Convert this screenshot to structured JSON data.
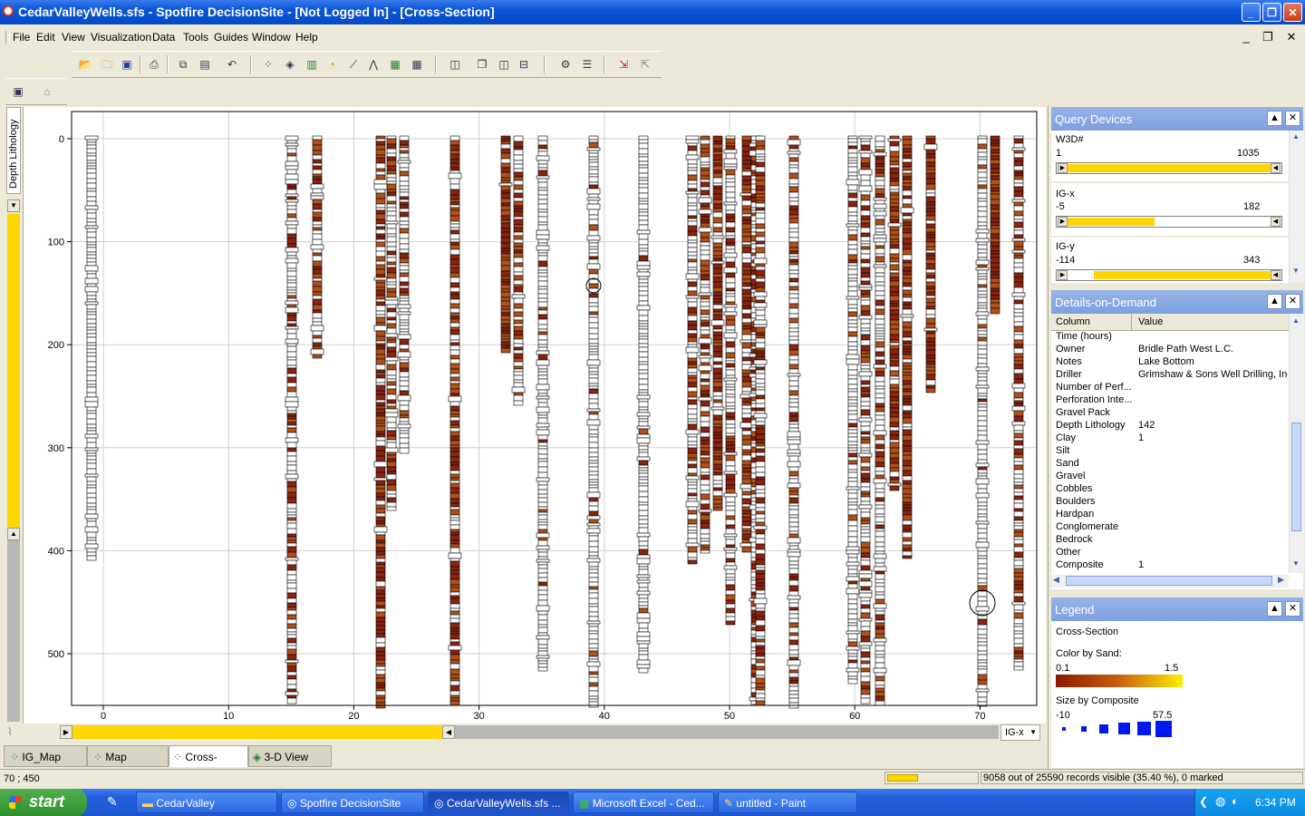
{
  "window": {
    "title": "CedarValleyWells.sfs - Spotfire DecisionSite - [Not Logged In] - [Cross-Section]"
  },
  "menu": [
    "File",
    "Edit",
    "View",
    "Visualization",
    "Data",
    "Tools",
    "Guides",
    "Window",
    "Help"
  ],
  "side_tab": {
    "label": "Depth Lithology"
  },
  "plot": {
    "x_ticks": [
      "0",
      "10",
      "20",
      "30",
      "40",
      "50",
      "60",
      "70"
    ],
    "y_ticks": [
      "0",
      "100",
      "200",
      "300",
      "400",
      "500"
    ],
    "x_axis_selector": "IG-x"
  },
  "query_devices": {
    "title": "Query Devices",
    "items": [
      {
        "label": "W3D#",
        "min": "1",
        "max": "1035",
        "range_lo": 0.0,
        "range_hi": 0.98
      },
      {
        "label": "IG-x",
        "min": "-5",
        "max": "182",
        "range_lo": 0.0,
        "range_hi": 0.43
      },
      {
        "label": "IG-y",
        "min": "-114",
        "max": "343",
        "range_lo": 0.16,
        "range_hi": 0.98
      }
    ]
  },
  "details": {
    "title": "Details-on-Demand",
    "col_header": "Column",
    "val_header": "Value",
    "rows": [
      {
        "c": "Time (hours)",
        "v": ""
      },
      {
        "c": "Owner",
        "v": "Bridle Path West L.C."
      },
      {
        "c": "Notes",
        "v": "Lake Bottom"
      },
      {
        "c": "Driller",
        "v": "Grimshaw & Sons Well Drilling, Inc."
      },
      {
        "c": "Number of Perf...",
        "v": ""
      },
      {
        "c": "Perforation Inte...",
        "v": ""
      },
      {
        "c": "Gravel Pack",
        "v": ""
      },
      {
        "c": "Depth Lithology",
        "v": "142"
      },
      {
        "c": "Clay",
        "v": "1"
      },
      {
        "c": "Silt",
        "v": ""
      },
      {
        "c": "Sand",
        "v": ""
      },
      {
        "c": "Gravel",
        "v": ""
      },
      {
        "c": "Cobbles",
        "v": ""
      },
      {
        "c": "Boulders",
        "v": ""
      },
      {
        "c": "Hardpan",
        "v": ""
      },
      {
        "c": "Conglomerate",
        "v": ""
      },
      {
        "c": "Bedrock",
        "v": ""
      },
      {
        "c": "Other",
        "v": ""
      },
      {
        "c": "Composite",
        "v": "1"
      }
    ]
  },
  "legend": {
    "title": "Legend",
    "viz_name": "Cross-Section",
    "color_label": "Color by Sand:",
    "color_min": "0.1",
    "color_max": "1.5",
    "size_label": "Size by Composite",
    "size_min": "-10",
    "size_max": "57.5"
  },
  "tabs": [
    "IG_Map",
    "Map",
    "Cross-Section",
    "3-D View"
  ],
  "status": {
    "coords": "70 ; 450",
    "records": "9058 out of 25590 records visible (35.40 %), 0 marked"
  },
  "taskbar": {
    "start": "start",
    "tasks": [
      "CedarValley",
      "Spotfire DecisionSite",
      "CedarValleyWells.sfs ...",
      "Microsoft Excel - Ced...",
      "untitled - Paint"
    ],
    "clock": "6:34 PM"
  }
}
